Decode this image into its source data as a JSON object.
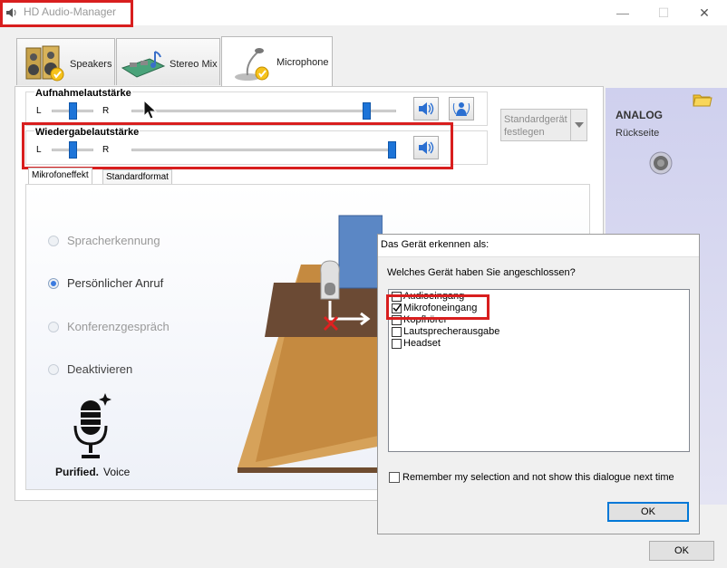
{
  "window": {
    "title": "HD Audio-Manager",
    "minimize_glyph": "—",
    "maximize_glyph": "☐",
    "close_glyph": "✕"
  },
  "tabs": [
    {
      "label": "Speakers",
      "icon": "speakers-icon"
    },
    {
      "label": "Stereo Mix",
      "icon": "stereo-mix-icon"
    },
    {
      "label": "Microphone",
      "icon": "microphone-icon"
    }
  ],
  "recording_volume": {
    "title": "Aufnahmelautstärke",
    "left": "L",
    "right": "R",
    "balance": 0.5,
    "level": 0.9
  },
  "playback_volume": {
    "title": "Wiedergabelautstärke",
    "left": "L",
    "right": "R",
    "balance": 0.5,
    "level": 1.0
  },
  "default_device": {
    "line1": "Standardgerät",
    "line2": "festlegen"
  },
  "analog": {
    "title": "ANALOG",
    "subtitle": "Rückseite"
  },
  "subtabs": [
    "Mikrofoneffekt",
    "Standardformat"
  ],
  "mic_effects": [
    {
      "label": "Spracherkennung",
      "selected": false
    },
    {
      "label": "Persönlicher Anruf",
      "selected": true
    },
    {
      "label": "Konferenzgespräch",
      "selected": false
    },
    {
      "label": "Deaktivieren",
      "selected": false
    }
  ],
  "brand": {
    "part1": "Purified.",
    "part2": "Voice"
  },
  "dialog": {
    "title": "Das Gerät erkennen als:",
    "question": "Welches Gerät haben Sie angeschlossen?",
    "options": [
      {
        "label": "Audioeingang",
        "checked": false
      },
      {
        "label": "Mikrofoneingang",
        "checked": true
      },
      {
        "label": "Kopfhörer",
        "checked": false
      },
      {
        "label": "Lautsprecherausgabe",
        "checked": false
      },
      {
        "label": "Headset",
        "checked": false
      }
    ],
    "remember_label": "Remember my selection and not show this dialogue next time",
    "ok_label": "OK"
  },
  "main_ok_label": "OK",
  "colors": {
    "accent_red": "#d81e1e",
    "slider_blue": "#1d74d8",
    "dialog_focus": "#0078d7"
  }
}
